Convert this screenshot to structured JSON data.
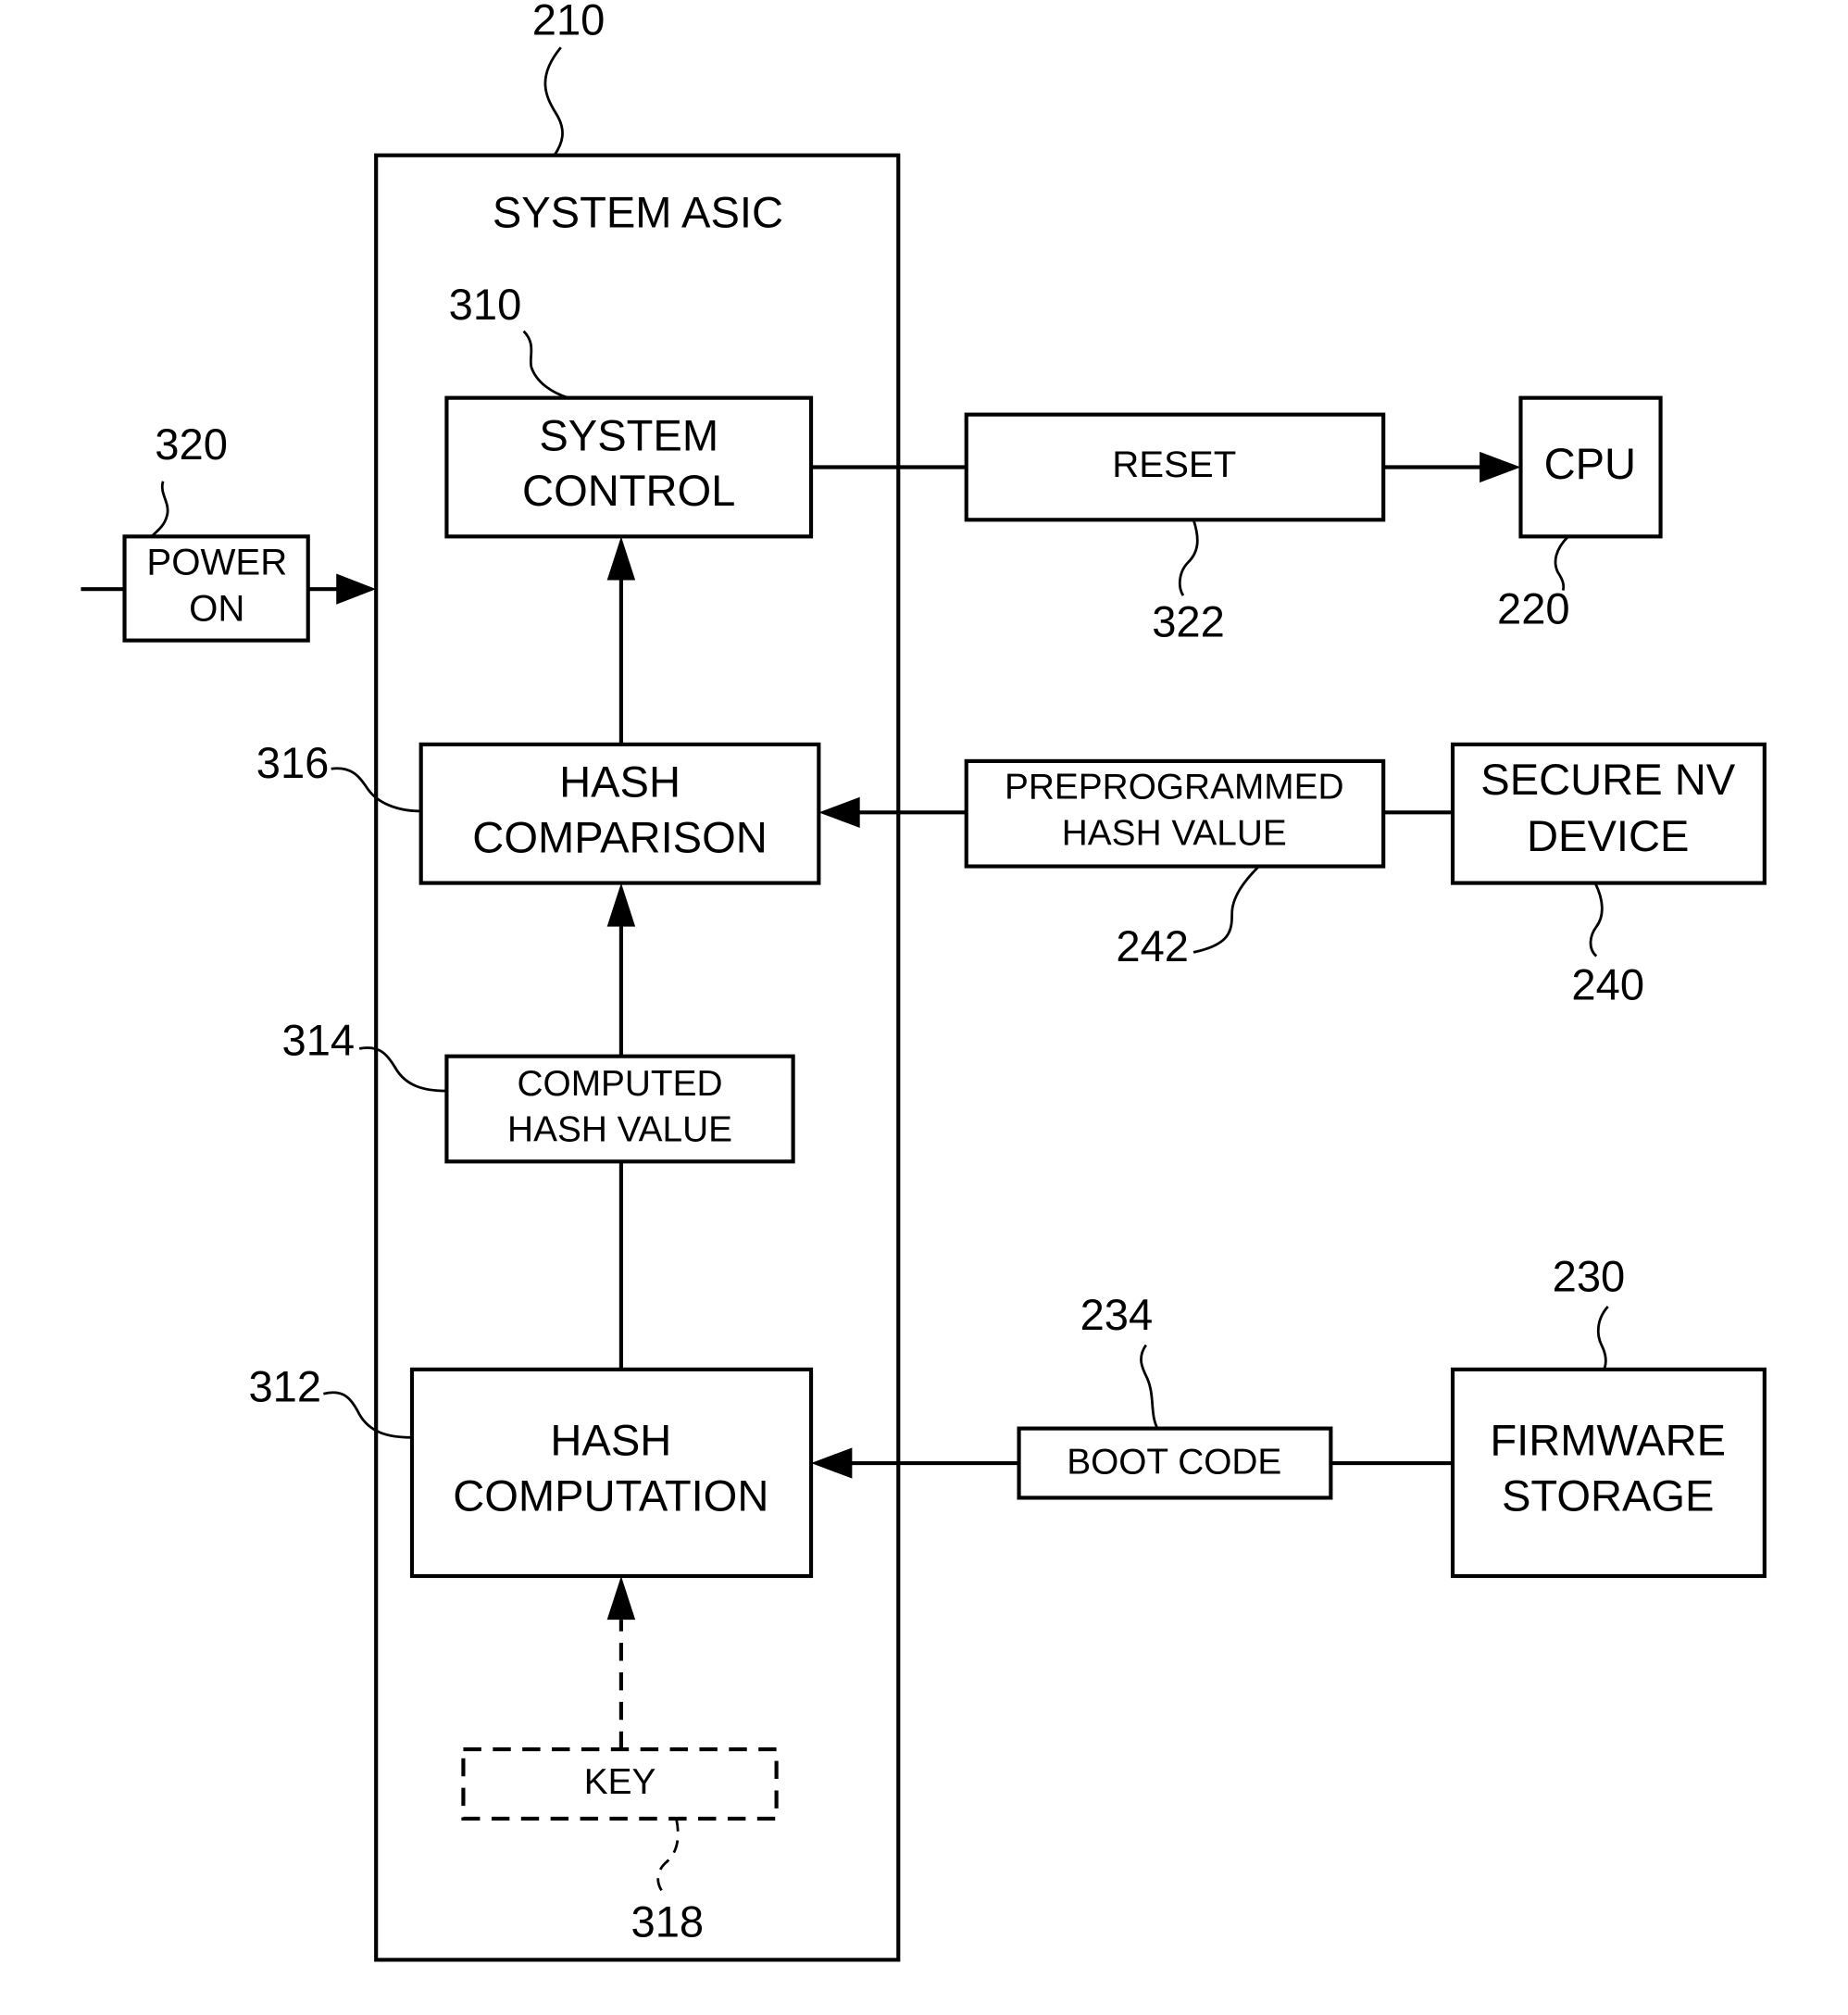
{
  "diagram": {
    "asic": {
      "ref": "210",
      "title": "SYSTEM ASIC"
    },
    "blocks": {
      "system_control": {
        "ref": "310",
        "line1": "SYSTEM",
        "line2": "CONTROL"
      },
      "hash_comparison": {
        "ref": "316",
        "line1": "HASH",
        "line2": "COMPARISON"
      },
      "computed_hash": {
        "ref": "314",
        "line1": "COMPUTED",
        "line2": "HASH VALUE"
      },
      "hash_computation": {
        "ref": "312",
        "line1": "HASH",
        "line2": "COMPUTATION"
      },
      "key": {
        "ref": "318",
        "label": "KEY"
      },
      "power_on": {
        "ref": "320",
        "line1": "POWER",
        "line2": "ON"
      },
      "reset": {
        "ref": "322",
        "label": "RESET"
      },
      "cpu": {
        "ref": "220",
        "label": "CPU"
      },
      "preprogrammed_hash": {
        "ref": "242",
        "line1": "PREPROGRAMMED",
        "line2": "HASH VALUE"
      },
      "secure_nv": {
        "ref": "240",
        "line1": "SECURE NV",
        "line2": "DEVICE"
      },
      "boot_code": {
        "ref": "234",
        "label": "BOOT CODE"
      },
      "firmware_storage": {
        "ref": "230",
        "line1": "FIRMWARE",
        "line2": "STORAGE"
      }
    }
  }
}
